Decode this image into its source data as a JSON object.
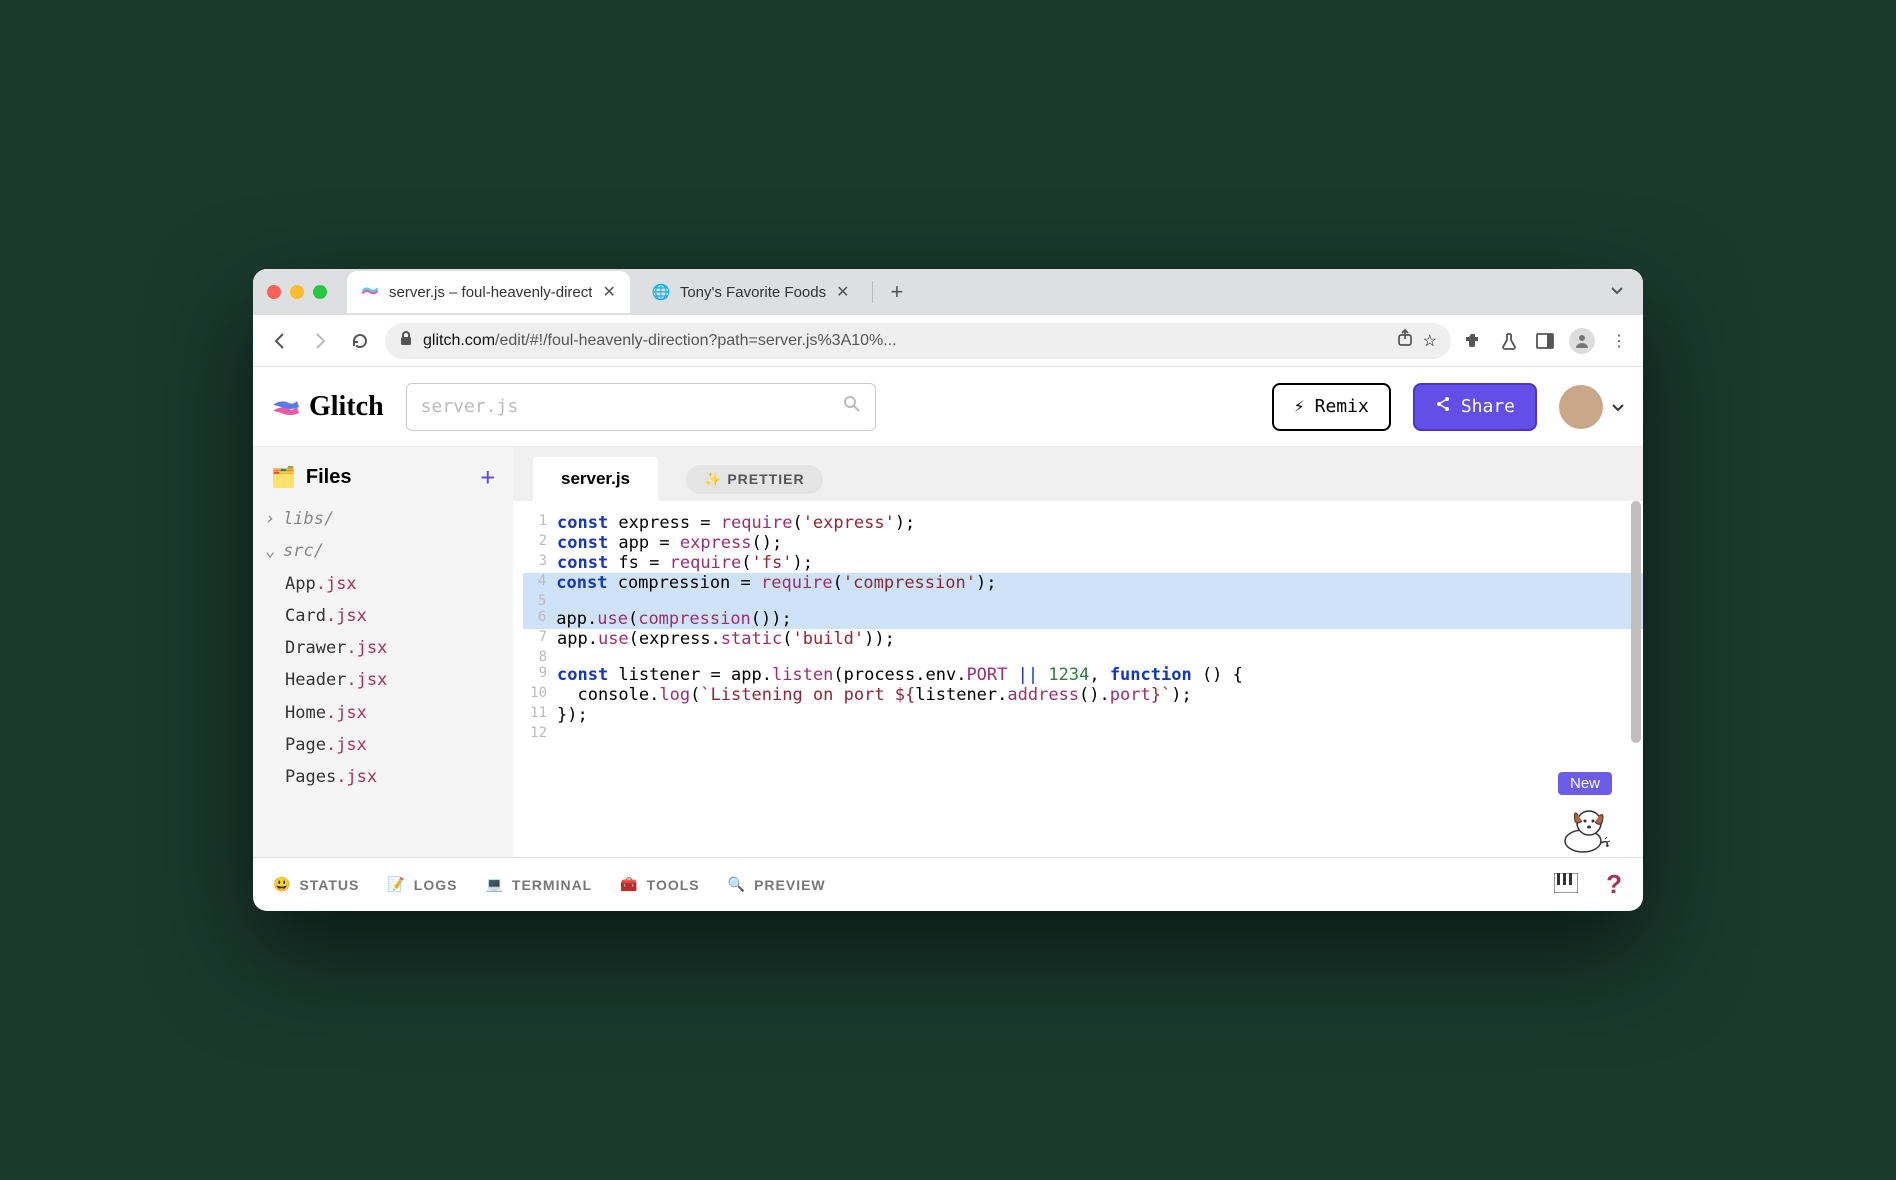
{
  "browser": {
    "tabs": [
      {
        "title": "server.js – foul-heavenly-direct",
        "active": true
      },
      {
        "title": "Tony's Favorite Foods",
        "active": false
      }
    ],
    "url_display_domain": "glitch.com",
    "url_display_path": "/edit/#!/foul-heavenly-direction?path=server.js%3A10%..."
  },
  "header": {
    "logo_text": "Glitch",
    "search_placeholder": "server.js",
    "remix_label": "Remix",
    "share_label": "Share"
  },
  "sidebar": {
    "files_label": "Files",
    "folders": [
      {
        "name": "libs/",
        "open": false
      },
      {
        "name": "src/",
        "open": true
      }
    ],
    "src_files": [
      {
        "base": "App",
        "ext": ".jsx"
      },
      {
        "base": "Card",
        "ext": ".jsx"
      },
      {
        "base": "Drawer",
        "ext": ".jsx"
      },
      {
        "base": "Header",
        "ext": ".jsx"
      },
      {
        "base": "Home",
        "ext": ".jsx"
      },
      {
        "base": "Page",
        "ext": ".jsx"
      },
      {
        "base": "Pages",
        "ext": ".jsx"
      }
    ]
  },
  "editor": {
    "active_file": "server.js",
    "prettier_label": "PRETTIER",
    "helper_badge": "New",
    "code_lines": [
      {
        "n": 1,
        "hl": false,
        "tokens": [
          [
            "kw",
            "const"
          ],
          [
            "",
            " express = "
          ],
          [
            "fn",
            "require"
          ],
          [
            "",
            "("
          ],
          [
            "str",
            "'express'"
          ],
          [
            "",
            ");"
          ]
        ]
      },
      {
        "n": 2,
        "hl": false,
        "tokens": [
          [
            "kw",
            "const"
          ],
          [
            "",
            " app = "
          ],
          [
            "fn",
            "express"
          ],
          [
            "",
            "();"
          ]
        ]
      },
      {
        "n": 3,
        "hl": false,
        "tokens": [
          [
            "kw",
            "const"
          ],
          [
            "",
            " fs = "
          ],
          [
            "fn",
            "require"
          ],
          [
            "",
            "("
          ],
          [
            "str",
            "'fs'"
          ],
          [
            "",
            ");"
          ]
        ]
      },
      {
        "n": 4,
        "hl": true,
        "tokens": [
          [
            "kw",
            "const"
          ],
          [
            "",
            " compression = "
          ],
          [
            "fn",
            "require"
          ],
          [
            "",
            "("
          ],
          [
            "str",
            "'compression'"
          ],
          [
            "",
            ");"
          ]
        ]
      },
      {
        "n": 5,
        "hl": true,
        "tokens": [
          [
            "",
            ""
          ]
        ]
      },
      {
        "n": 6,
        "hl": true,
        "tokens": [
          [
            "",
            "app."
          ],
          [
            "fn",
            "use"
          ],
          [
            "",
            "("
          ],
          [
            "fn",
            "compression"
          ],
          [
            "",
            "());"
          ]
        ]
      },
      {
        "n": 7,
        "hl": false,
        "tokens": [
          [
            "",
            "app."
          ],
          [
            "fn",
            "use"
          ],
          [
            "",
            "(express."
          ],
          [
            "fn",
            "static"
          ],
          [
            "",
            "("
          ],
          [
            "str",
            "'build'"
          ],
          [
            "",
            "));"
          ]
        ]
      },
      {
        "n": 8,
        "hl": false,
        "tokens": [
          [
            "",
            ""
          ]
        ]
      },
      {
        "n": 9,
        "hl": false,
        "tokens": [
          [
            "kw",
            "const"
          ],
          [
            "",
            " listener = app."
          ],
          [
            "fn",
            "listen"
          ],
          [
            "",
            "(process.env."
          ],
          [
            "fn",
            "PORT"
          ],
          [
            "",
            " "
          ],
          [
            "op",
            "||"
          ],
          [
            "",
            " "
          ],
          [
            "num",
            "1234"
          ],
          [
            "",
            ", "
          ],
          [
            "kw",
            "function"
          ],
          [
            "",
            " () {"
          ]
        ]
      },
      {
        "n": 10,
        "hl": false,
        "tokens": [
          [
            "",
            "  console."
          ],
          [
            "fn",
            "log"
          ],
          [
            "",
            "("
          ],
          [
            "str",
            "`Listening on port ${"
          ],
          [
            "",
            "listener."
          ],
          [
            "fn",
            "address"
          ],
          [
            "",
            "()."
          ],
          [
            "fn",
            "port"
          ],
          [
            "str",
            "}`"
          ],
          [
            "",
            ");"
          ]
        ]
      },
      {
        "n": 11,
        "hl": false,
        "tokens": [
          [
            "",
            "});"
          ]
        ]
      },
      {
        "n": 12,
        "hl": false,
        "tokens": [
          [
            "",
            ""
          ]
        ]
      }
    ]
  },
  "footer": {
    "items": [
      {
        "emoji": "😃",
        "label": "STATUS"
      },
      {
        "emoji": "📝",
        "label": "LOGS"
      },
      {
        "emoji": "💻",
        "label": "TERMINAL"
      },
      {
        "emoji": "🧰",
        "label": "TOOLS"
      },
      {
        "emoji": "🔍",
        "label": "PREVIEW"
      }
    ],
    "help": "?"
  }
}
